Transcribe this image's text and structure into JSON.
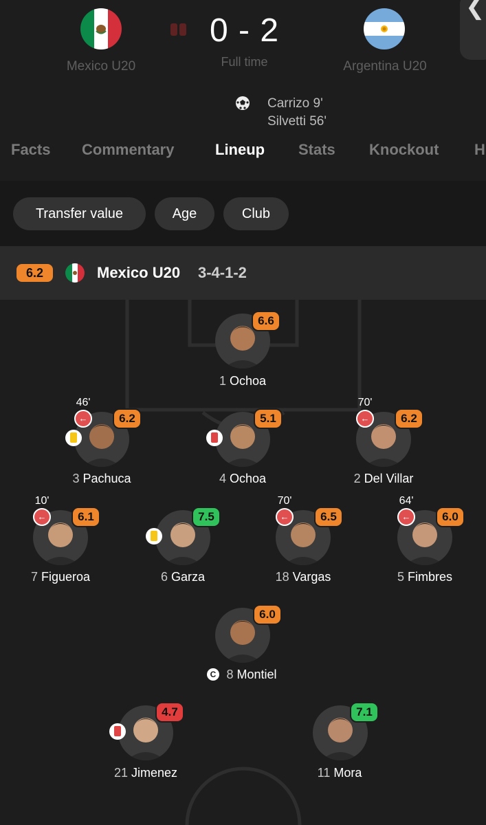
{
  "match": {
    "home_team": "Mexico U20",
    "away_team": "Argentina U20",
    "score": "0 - 2",
    "status": "Full time",
    "scorers": [
      "Carrizo 9'",
      "Silvetti 56'"
    ]
  },
  "tabs": [
    "Facts",
    "Commentary",
    "Lineup",
    "Stats",
    "Knockout",
    "H"
  ],
  "active_tab": "Lineup",
  "filters": [
    "Transfer value",
    "Age",
    "Club"
  ],
  "lineup": {
    "team_rating": "6.2",
    "team_name": "Mexico U20",
    "formation": "3-4-1-2"
  },
  "players": [
    {
      "number": "1",
      "name": "Ochoa",
      "rating": "6.6",
      "rating_color": "orange"
    },
    {
      "number": "3",
      "name": "Pachuca",
      "rating": "6.2",
      "rating_color": "orange",
      "sub_minute": "46'",
      "card": "yellow"
    },
    {
      "number": "4",
      "name": "Ochoa",
      "rating": "5.1",
      "rating_color": "orange",
      "card": "red"
    },
    {
      "number": "2",
      "name": "Del Villar",
      "rating": "6.2",
      "rating_color": "orange",
      "sub_minute": "70'"
    },
    {
      "number": "7",
      "name": "Figueroa",
      "rating": "6.1",
      "rating_color": "orange",
      "sub_minute": "10'"
    },
    {
      "number": "6",
      "name": "Garza",
      "rating": "7.5",
      "rating_color": "green",
      "card": "yellow"
    },
    {
      "number": "18",
      "name": "Vargas",
      "rating": "6.5",
      "rating_color": "orange",
      "sub_minute": "70'"
    },
    {
      "number": "5",
      "name": "Fimbres",
      "rating": "6.0",
      "rating_color": "orange",
      "sub_minute": "64'"
    },
    {
      "number": "8",
      "name": "Montiel",
      "rating": "6.0",
      "rating_color": "orange",
      "captain_label": "C"
    },
    {
      "number": "21",
      "name": "Jimenez",
      "rating": "4.7",
      "rating_color": "red",
      "card": "red"
    },
    {
      "number": "11",
      "name": "Mora",
      "rating": "7.1",
      "rating_color": "green"
    }
  ],
  "colors": {
    "background": "#1d1d1d",
    "rating_orange": "#f0862b",
    "rating_green": "#30c35b",
    "rating_red": "#e23d3d",
    "sub_red": "#e05050",
    "card_yellow": "#f5c518",
    "card_red": "#e04545"
  },
  "icons": {
    "goal": "football-icon",
    "substitution": "sub-out-arrow-icon",
    "captain": "captain-icon",
    "back": "chevron-left-icon"
  }
}
